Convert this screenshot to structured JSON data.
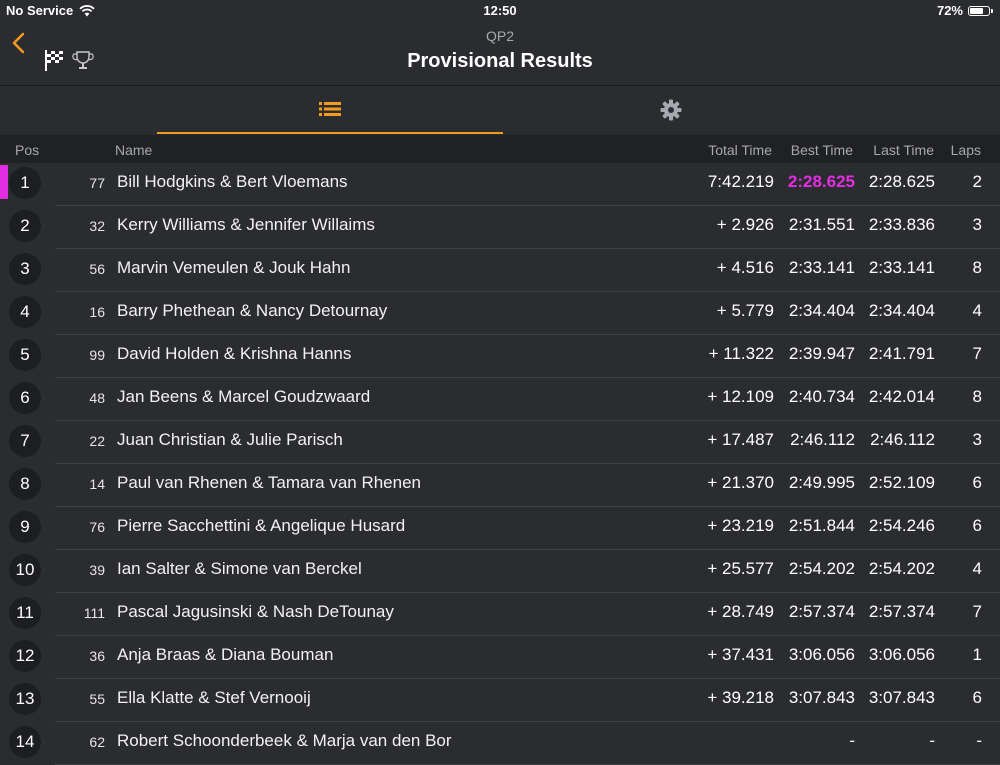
{
  "status": {
    "carrier": "No Service",
    "time": "12:50",
    "battery": "72%",
    "battery_level": 0.72
  },
  "header": {
    "subtitle": "QP2",
    "title": "Provisional Results"
  },
  "columns": {
    "pos": "Pos",
    "name": "Name",
    "total": "Total Time",
    "best": "Best Time",
    "last": "Last Time",
    "laps": "Laps"
  },
  "colors": {
    "accent": "#f39b1e",
    "fastest": "#e22ee0",
    "background": "#2b2c30"
  },
  "rows": [
    {
      "pos": "1",
      "num": "77",
      "name": "Bill Hodgkins & Bert Vloemans",
      "total": "7:42.219",
      "best": "2:28.625",
      "last": "2:28.625",
      "laps": "2",
      "fastest": true
    },
    {
      "pos": "2",
      "num": "32",
      "name": "Kerry Williams & Jennifer Willaims",
      "total": "+ 2.926",
      "best": "2:31.551",
      "last": "2:33.836",
      "laps": "3"
    },
    {
      "pos": "3",
      "num": "56",
      "name": "Marvin Vemeulen & Jouk Hahn",
      "total": "+ 4.516",
      "best": "2:33.141",
      "last": "2:33.141",
      "laps": "8"
    },
    {
      "pos": "4",
      "num": "16",
      "name": "Barry Phethean & Nancy Detournay",
      "total": "+ 5.779",
      "best": "2:34.404",
      "last": "2:34.404",
      "laps": "4"
    },
    {
      "pos": "5",
      "num": "99",
      "name": "David Holden & Krishna Hanns",
      "total": "+ 11.322",
      "best": "2:39.947",
      "last": "2:41.791",
      "laps": "7"
    },
    {
      "pos": "6",
      "num": "48",
      "name": "Jan Beens & Marcel Goudzwaard",
      "total": "+ 12.109",
      "best": "2:40.734",
      "last": "2:42.014",
      "laps": "8"
    },
    {
      "pos": "7",
      "num": "22",
      "name": "Juan Christian & Julie Parisch",
      "total": "+ 17.487",
      "best": "2:46.112",
      "last": "2:46.112",
      "laps": "3"
    },
    {
      "pos": "8",
      "num": "14",
      "name": "Paul van Rhenen & Tamara van Rhenen",
      "total": "+ 21.370",
      "best": "2:49.995",
      "last": "2:52.109",
      "laps": "6"
    },
    {
      "pos": "9",
      "num": "76",
      "name": "Pierre Sacchettini & Angelique Husard",
      "total": "+ 23.219",
      "best": "2:51.844",
      "last": "2:54.246",
      "laps": "6"
    },
    {
      "pos": "10",
      "num": "39",
      "name": "Ian Salter & Simone van Berckel",
      "total": "+ 25.577",
      "best": "2:54.202",
      "last": "2:54.202",
      "laps": "4"
    },
    {
      "pos": "11",
      "num": "111",
      "name": "Pascal Jagusinski & Nash DeTounay",
      "total": "+ 28.749",
      "best": "2:57.374",
      "last": "2:57.374",
      "laps": "7"
    },
    {
      "pos": "12",
      "num": "36",
      "name": "Anja Braas & Diana Bouman",
      "total": "+ 37.431",
      "best": "3:06.056",
      "last": "3:06.056",
      "laps": "1"
    },
    {
      "pos": "13",
      "num": "55",
      "name": "Ella Klatte & Stef Vernooij",
      "total": "+ 39.218",
      "best": "3:07.843",
      "last": "3:07.843",
      "laps": "6"
    },
    {
      "pos": "14",
      "num": "62",
      "name": "Robert Schoonderbeek & Marja van den Bor",
      "total": "",
      "best": "-",
      "last": "-",
      "laps": "-"
    }
  ]
}
